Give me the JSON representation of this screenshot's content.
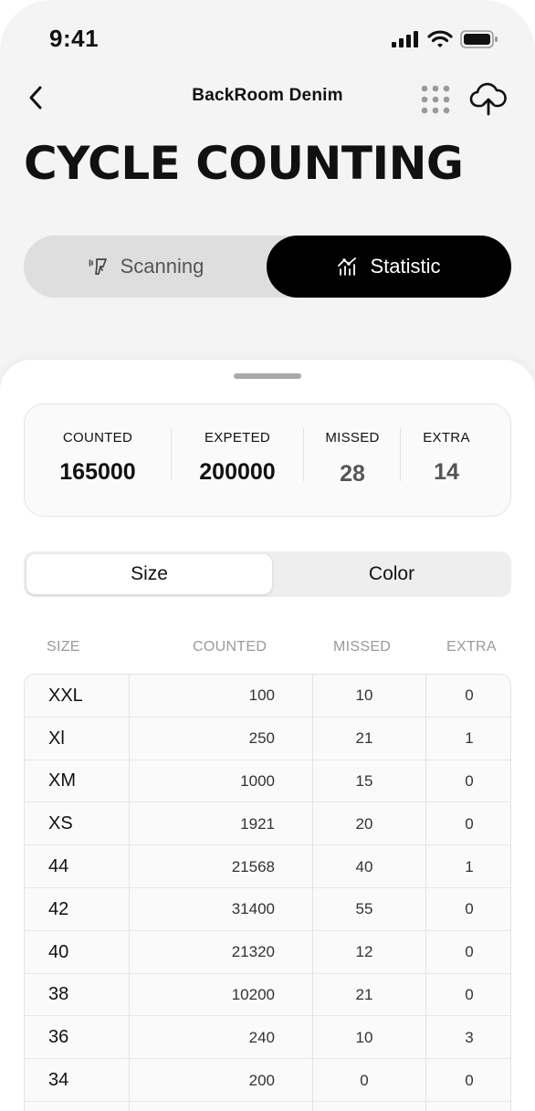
{
  "status_bar": {
    "time": "9:41"
  },
  "nav": {
    "title": "BackRoom Denim"
  },
  "page": {
    "title": "CYCLE COUNTING"
  },
  "mode_toggle": {
    "scanning": "Scanning",
    "statistic": "Statistic",
    "active": "Statistic"
  },
  "summary": [
    {
      "label": "COUNTED",
      "value": "165000"
    },
    {
      "label": "EXPETED",
      "value": "200000"
    },
    {
      "label": "MISSED",
      "value": "28"
    },
    {
      "label": "EXTRA",
      "value": "14"
    }
  ],
  "grouping": {
    "size": "Size",
    "color": "Color",
    "active": "Size"
  },
  "table": {
    "columns": [
      "SIZE",
      "COUNTED",
      "MISSED",
      "EXTRA"
    ],
    "rows": [
      {
        "size": "XXL",
        "counted": "100",
        "missed": "10",
        "extra": "0"
      },
      {
        "size": "Xl",
        "counted": "250",
        "missed": "21",
        "extra": "1"
      },
      {
        "size": "XM",
        "counted": "1000",
        "missed": "15",
        "extra": "0"
      },
      {
        "size": "XS",
        "counted": "1921",
        "missed": "20",
        "extra": "0"
      },
      {
        "size": "44",
        "counted": "21568",
        "missed": "40",
        "extra": "1"
      },
      {
        "size": "42",
        "counted": "31400",
        "missed": "55",
        "extra": "0"
      },
      {
        "size": "40",
        "counted": "21320",
        "missed": "12",
        "extra": "0"
      },
      {
        "size": "38",
        "counted": "10200",
        "missed": "21",
        "extra": "0"
      },
      {
        "size": "36",
        "counted": "240",
        "missed": "10",
        "extra": "3"
      },
      {
        "size": "34",
        "counted": "200",
        "missed": "0",
        "extra": "0"
      }
    ]
  },
  "icons": {
    "back": "chevron-left-icon",
    "grid": "grid-dots-icon",
    "upload": "cloud-upload-icon",
    "scanner": "barcode-scanner-icon",
    "statistic": "chart-icon",
    "signal": "signal-icon",
    "wifi": "wifi-icon",
    "battery": "battery-icon"
  }
}
